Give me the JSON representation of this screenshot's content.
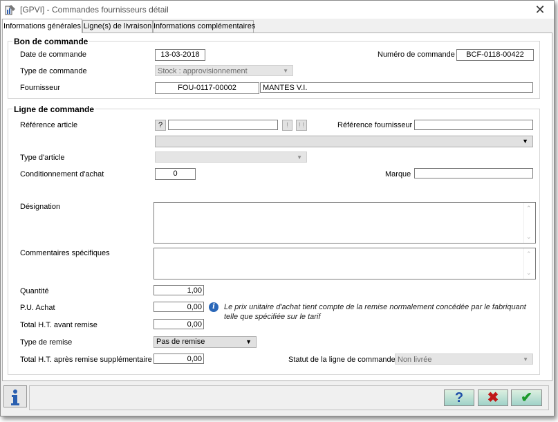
{
  "window": {
    "title": "[GPVI] - Commandes fournisseurs détail",
    "close_glyph": "✕"
  },
  "tabs": [
    {
      "label": "Informations générales",
      "active": true
    },
    {
      "label": "Ligne(s) de livraison",
      "active": false
    },
    {
      "label": "Informations complémentaires",
      "active": false
    }
  ],
  "bon_de_commande": {
    "title": "Bon de commande",
    "date_label": "Date de commande",
    "date_value": "13-03-2018",
    "numero_label": "Numéro de commande",
    "numero_value": "BCF-0118-00422",
    "type_label": "Type de commande",
    "type_value": "Stock : approvisionnement",
    "fournisseur_label": "Fournisseur",
    "fournisseur_code": "FOU-0117-00002",
    "fournisseur_name": "MANTES V.I."
  },
  "ligne_de_commande": {
    "title": "Ligne de commande",
    "ref_article_label": "Référence article",
    "ref_article_help": "?",
    "ref_article_value": "",
    "btn_single": "!",
    "btn_double": "! !",
    "ref_fournisseur_label": "Référence fournisseur",
    "ref_fournisseur_value": "",
    "article_select_value": "",
    "type_article_label": "Type d'article",
    "type_article_value": "",
    "conditionnement_label": "Conditionnement d'achat",
    "conditionnement_value": "0",
    "marque_label": "Marque",
    "marque_value": "",
    "designation_label": "Désignation",
    "commentaires_label": "Commentaires spécifiques",
    "quantite_label": "Quantité",
    "quantite_value": "1,00",
    "pu_label": "P.U. Achat",
    "pu_value": "0,00",
    "pu_note": "Le prix unitaire d'achat tient compte de la remise normalement concédée par le fabriquant telle que spécifiée sur le tarif",
    "total_avant_label": "Total H.T. avant remise",
    "total_avant_value": "0,00",
    "type_remise_label": "Type de remise",
    "type_remise_value": "Pas de remise",
    "total_apres_label": "Total H.T. après remise supplémentaire",
    "total_apres_value": "0,00",
    "statut_label": "Statut de la ligne de commande",
    "statut_value": "Non livrée"
  },
  "footer": {
    "info_icon": "info-icon",
    "help_glyph": "?",
    "cancel_glyph": "✖",
    "ok_glyph": "✔"
  },
  "colors": {
    "help": "#1f4fa8",
    "cancel": "#c01818",
    "ok": "#1a9a2a",
    "info": "#2a67b8"
  }
}
